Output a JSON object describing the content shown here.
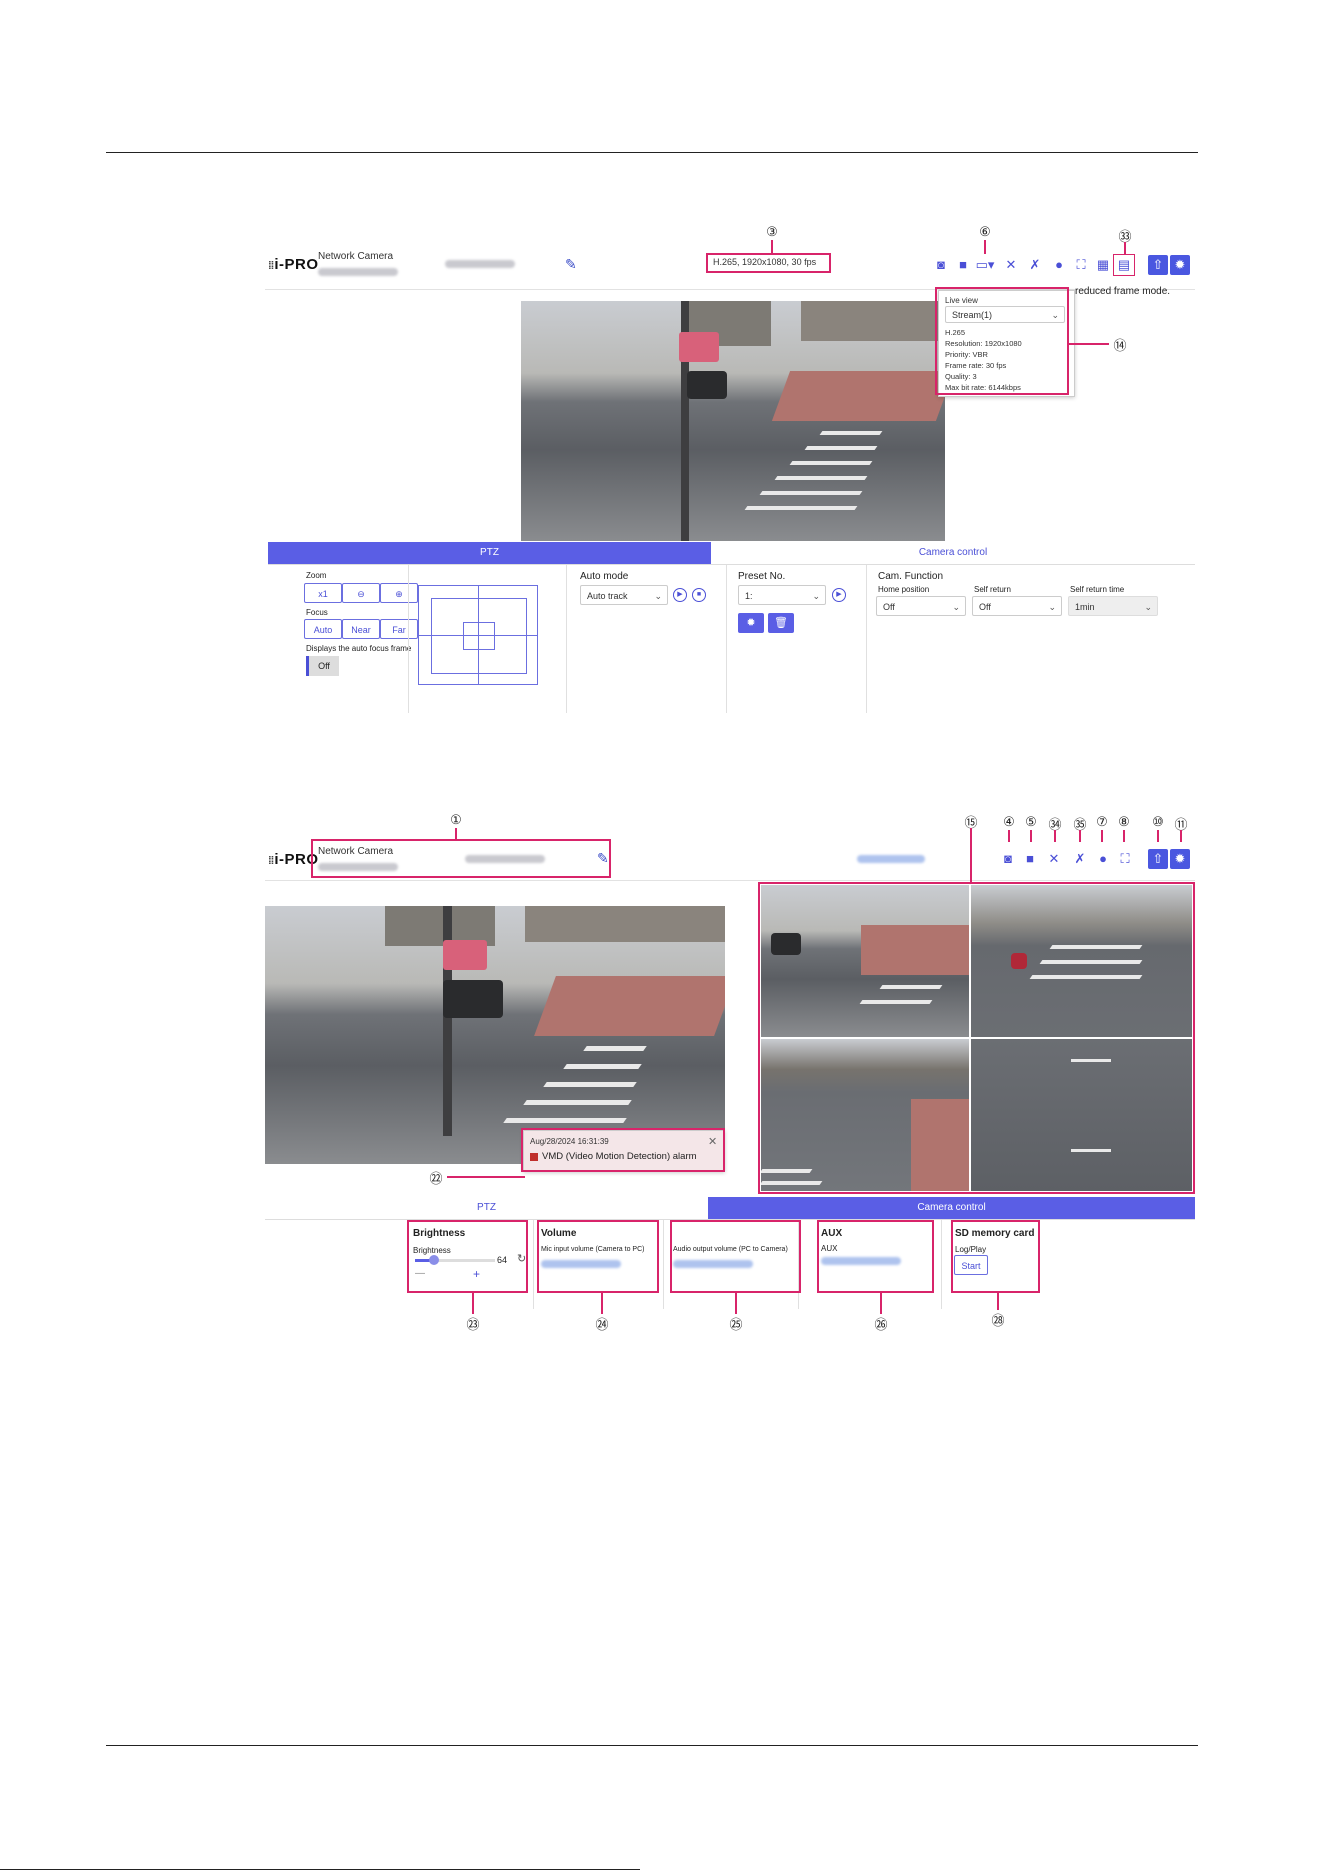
{
  "top_screen": {
    "logo": "i-PRO",
    "product": "Network Camera",
    "stream_info": "H.265, 1920x1080, 30 fps",
    "side_note": "reduced frame mode.",
    "live_view_popup": {
      "title": "Live view",
      "stream_select": "Stream(1)",
      "codec": "H.265",
      "resolution": "Resolution: 1920x1080",
      "priority": "Priority: VBR",
      "frame_rate": "Frame rate: 30 fps",
      "quality": "Quality: 3",
      "max_bit_rate": "Max bit rate: 6144kbps"
    },
    "tabs": {
      "ptz": "PTZ",
      "camera_control": "Camera control"
    },
    "ptz": {
      "zoom_label": "Zoom",
      "zoom_x1": "x1",
      "focus_label": "Focus",
      "focus_auto": "Auto",
      "focus_near": "Near",
      "focus_far": "Far",
      "af_frame_label": "Displays the auto focus frame",
      "af_frame_value": "Off",
      "auto_mode_label": "Auto mode",
      "auto_mode_value": "Auto track",
      "preset_label": "Preset No.",
      "preset_value": "1:",
      "cam_function_label": "Cam. Function",
      "home_position_label": "Home position",
      "home_position_value": "Off",
      "self_return_label": "Self return",
      "self_return_value": "Off",
      "self_return_time_label": "Self return time",
      "self_return_time_value": "1min"
    },
    "callouts": {
      "c3": "③",
      "c6": "⑥",
      "c33": "㉝",
      "c14": "⑭"
    }
  },
  "bottom_screen": {
    "logo": "i-PRO",
    "product": "Network Camera",
    "alarm_time": "Aug/28/2024 16:31:39",
    "alarm_text": "VMD (Video Motion Detection) alarm",
    "tabs": {
      "ptz": "PTZ",
      "camera_control": "Camera control"
    },
    "brightness": {
      "title": "Brightness",
      "label": "Brightness",
      "value": "64",
      "minus": "—",
      "plus": "+"
    },
    "volume": {
      "title": "Volume",
      "mic_label": "Mic input volume (Camera to PC)",
      "audio_label": "Audio output volume (PC to Camera)"
    },
    "aux": {
      "title": "AUX",
      "label": "AUX"
    },
    "sd": {
      "title": "SD memory card",
      "label": "Log/Play",
      "start": "Start"
    },
    "callouts": {
      "c1": "①",
      "c15": "⑮",
      "c4": "④",
      "c5": "⑤",
      "c34": "㉞",
      "c35": "㉟",
      "c7": "⑦",
      "c8": "⑧",
      "c10": "⑩",
      "c11": "⑪",
      "c22": "㉒",
      "c23": "㉓",
      "c24": "㉔",
      "c25": "㉕",
      "c26": "㉖",
      "c28": "㉘"
    }
  },
  "icons": [
    "camera-icon",
    "video-icon",
    "stream-menu-icon",
    "speaker-mute-icon",
    "mic-mute-icon",
    "help-icon",
    "fullscreen-icon",
    "grid-icon",
    "sd-card-icon",
    "live-icon",
    "settings-icon"
  ],
  "colors": {
    "accent": "#5a5ee5",
    "callout": "#d8246a"
  }
}
